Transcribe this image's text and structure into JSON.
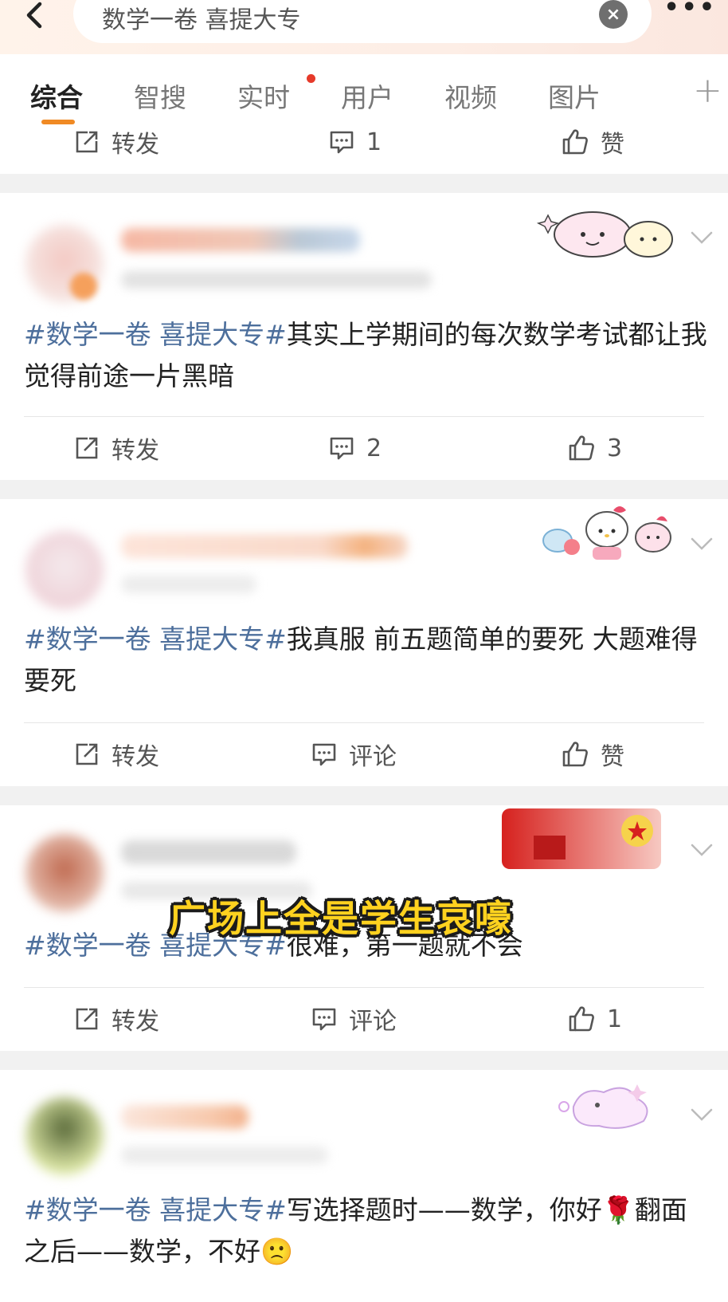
{
  "search": {
    "query": "数学一卷 喜提大专",
    "clear_symbol": "×",
    "more_symbol": "•••"
  },
  "tabs": [
    {
      "label": "综合",
      "active": true
    },
    {
      "label": "智搜"
    },
    {
      "label": "实时",
      "has_dot": true
    },
    {
      "label": "用户"
    },
    {
      "label": "视频"
    },
    {
      "label": "图片"
    }
  ],
  "tabs_plus": "+",
  "top_actions": {
    "repost": "转发",
    "comment": "1",
    "like": "赞"
  },
  "posts": [
    {
      "tag": "#数学一卷 喜提大专#",
      "text": "其实上学期间的每次数学考试都让我觉得前途一片黑暗",
      "repost": "转发",
      "comment": "2",
      "like": "3"
    },
    {
      "tag": "#数学一卷 喜提大专#",
      "text": "我真服 前五题简单的要死 大题难得要死",
      "repost": "转发",
      "comment": "评论",
      "like": "赞"
    },
    {
      "tag": "#数学一卷 喜提大专#",
      "text": "很难，第一题就不会",
      "repost": "转发",
      "comment": "评论",
      "like": "1"
    },
    {
      "tag": "#数学一卷 喜提大专#",
      "text": "写选择题时——数学，你好🌹翻面之后——数学，不好🙁"
    }
  ],
  "video_caption": "广场上全是学生哀嚎",
  "colors": {
    "accent": "#f08a24",
    "topic": "#4d6f9c",
    "dot": "#e63a2a",
    "caption": "#ffd21f"
  },
  "icons": {
    "back": "chevron-left-icon",
    "repost": "share-box-icon",
    "comment": "comment-icon",
    "like": "thumbs-up-icon",
    "menu": "chevron-down-icon"
  }
}
